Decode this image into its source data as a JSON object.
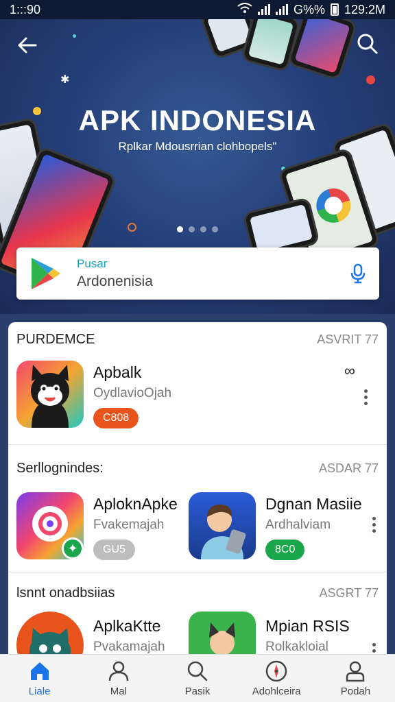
{
  "status_bar": {
    "time": "1:::90",
    "battery": "G%%",
    "clock": "129:2M"
  },
  "hero": {
    "title": "APK INDONESIA",
    "subtitle": "Rplkar Mdousrrian clohbopels\"",
    "pager": {
      "count": 4,
      "active": 0
    }
  },
  "search": {
    "label": "Pusar",
    "value": "Ardonenisia"
  },
  "sections": [
    {
      "title": "PURDEMCE",
      "more": "ASVRIT 77",
      "apps": [
        {
          "name": "Apbalk",
          "subtitle": "OydlaviоOjah",
          "badge": "C808",
          "badge_color": "#e8541c"
        }
      ]
    },
    {
      "title": "Serllognindes:",
      "more": "ASDAR 77",
      "apps": [
        {
          "name": "AploknApke",
          "subtitle": "Fvakemajah",
          "badge": "GU5",
          "badge_color": "#bdbdbd"
        },
        {
          "name": "Dgnan Masiie",
          "subtitle": "Ardhalviam",
          "badge": "8C0",
          "badge_color": "#1aa64b"
        }
      ]
    },
    {
      "title": "lsnnt onadbsiias",
      "more": "ASGRT 77",
      "apps": [
        {
          "name": "AplkaKtte",
          "subtitle": "Pvakamajah"
        },
        {
          "name": "Mpian RSIS",
          "subtitle": "Rolkakloial"
        }
      ]
    }
  ],
  "nav": [
    {
      "label": "Liale",
      "icon": "home-icon"
    },
    {
      "label": "Mal",
      "icon": "person-icon"
    },
    {
      "label": "Pasik",
      "icon": "search-icon"
    },
    {
      "label": "Adohlceira",
      "icon": "compass-icon"
    },
    {
      "label": "Podah",
      "icon": "profile-icon"
    }
  ]
}
